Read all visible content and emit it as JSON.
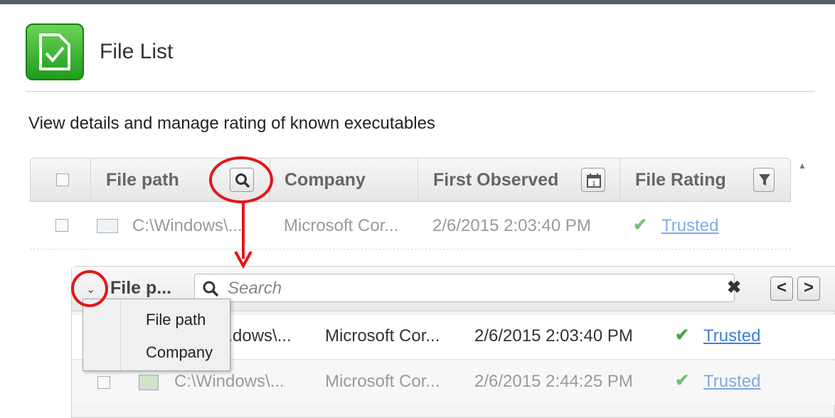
{
  "page": {
    "title": "File List",
    "subtitle": "View details and manage rating of known executables"
  },
  "table": {
    "columns": [
      "File path",
      "Company",
      "First Observed",
      "File Rating"
    ],
    "header_icons": [
      "search-icon",
      "calendar-icon",
      "filter-icon"
    ],
    "row": {
      "path": "C:\\Windows\\...",
      "company": "Microsoft Cor...",
      "first_observed": "2/6/2015 2:03:40 PM",
      "rating": "Trusted"
    }
  },
  "search_panel": {
    "scope_label": "File p...",
    "placeholder": "Search",
    "scope_options": [
      "File path",
      "Company"
    ],
    "rows": [
      {
        "path": "...dows\\...",
        "company": "Microsoft Cor...",
        "first_observed": "2/6/2015 2:03:40 PM",
        "rating": "Trusted"
      },
      {
        "path": "C:\\Windows\\...",
        "company": "Microsoft Cor...",
        "first_observed": "2/6/2015 2:44:25 PM",
        "rating": "Trusted"
      }
    ],
    "nav": {
      "prev": "<",
      "next": ">",
      "clear": "✖"
    }
  },
  "colors": {
    "accent_green": "#2aa92a",
    "annotation_red": "#e2171b",
    "link_blue": "#3d7fdc"
  }
}
